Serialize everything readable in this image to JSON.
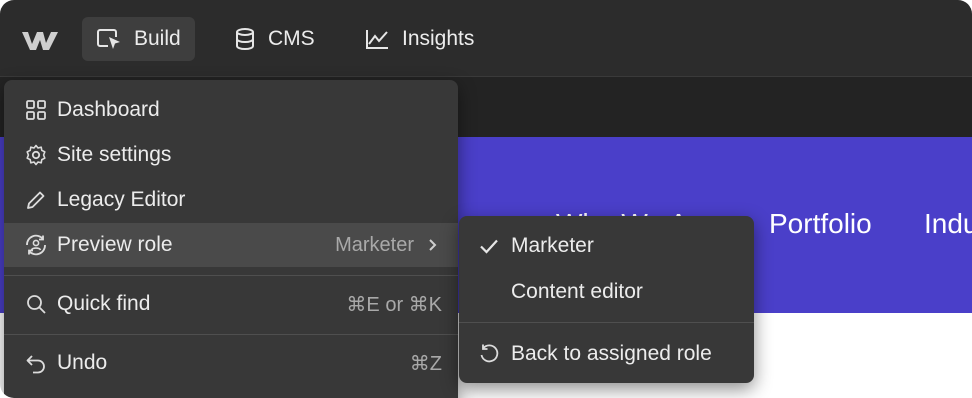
{
  "topbar": {
    "logo_icon": "webflow-logo-icon",
    "tabs": [
      {
        "label": "Build",
        "icon": "cursor-box-icon"
      },
      {
        "label": "CMS",
        "icon": "database-icon"
      },
      {
        "label": "Insights",
        "icon": "line-chart-icon"
      }
    ]
  },
  "canvas": {
    "hero_color": "#4a3fc9",
    "nav_items": [
      "Who We Are",
      "Portfolio",
      "Indu"
    ]
  },
  "menu": {
    "items": [
      {
        "label": "Dashboard",
        "icon": "grid-icon"
      },
      {
        "label": "Site settings",
        "icon": "gear-icon"
      },
      {
        "label": "Legacy Editor",
        "icon": "pencil-icon"
      },
      {
        "label": "Preview role",
        "icon": "preview-role-icon",
        "value": "Marketer"
      },
      {
        "label": "Quick find",
        "icon": "search-icon",
        "shortcut": "⌘E or ⌘K"
      },
      {
        "label": "Undo",
        "icon": "undo-icon",
        "shortcut": "⌘Z"
      }
    ]
  },
  "submenu": {
    "items": [
      {
        "label": "Marketer",
        "checked": true
      },
      {
        "label": "Content editor",
        "checked": false
      },
      {
        "label": "Back to assigned role",
        "icon": "reset-icon"
      }
    ]
  }
}
